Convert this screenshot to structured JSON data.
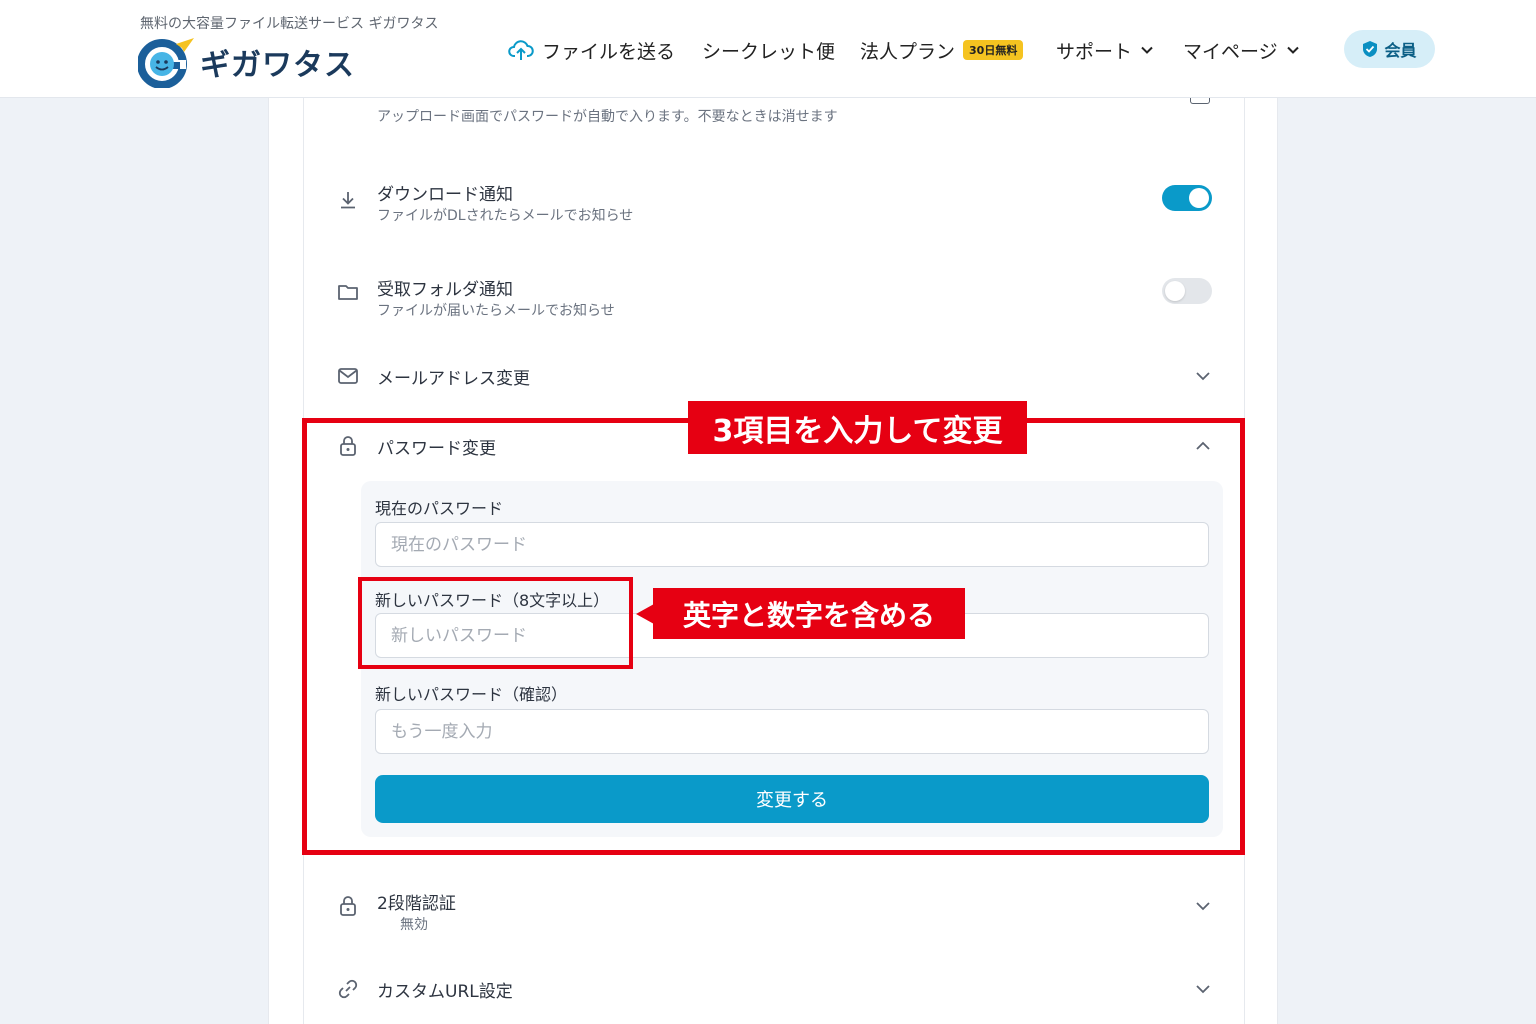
{
  "header": {
    "tagline": "無料の大容量ファイル転送サービス ギガワタス",
    "logo_text": "ギガワタス",
    "nav": {
      "send": "ファイルを送る",
      "secret": "シークレット便",
      "corp": "法人プラン",
      "corp_badge": "30日無料",
      "support": "サポート",
      "mypage": "マイページ"
    },
    "member_label": "会員"
  },
  "settings": {
    "auto_password_desc": "アップロード画面でパスワードが自動で入ります。不要なときは消せます",
    "download_notice": {
      "title": "ダウンロード通知",
      "desc": "ファイルがDLされたらメールでお知らせ",
      "enabled": true
    },
    "folder_notice": {
      "title": "受取フォルダ通知",
      "desc": "ファイルが届いたらメールでお知らせ",
      "enabled": false
    },
    "email_change": {
      "title": "メールアドレス変更"
    },
    "password_change": {
      "title": "パスワード変更",
      "current_label": "現在のパスワード",
      "current_placeholder": "現在のパスワード",
      "new_label": "新しいパスワード（8文字以上）",
      "new_placeholder": "新しいパスワード",
      "confirm_label": "新しいパスワード（確認）",
      "confirm_placeholder": "もう一度入力",
      "submit_label": "変更する"
    },
    "two_factor": {
      "title": "2段階認証",
      "status": "無効"
    },
    "custom_url": {
      "title": "カスタムURL設定"
    }
  },
  "annotations": {
    "top_label": "3項目を入力して変更",
    "side_label": "英字と数字を含める"
  },
  "colors": {
    "accent": "#0a9ac9",
    "annotation_red": "#e60012",
    "badge_yellow": "#f5c320"
  }
}
